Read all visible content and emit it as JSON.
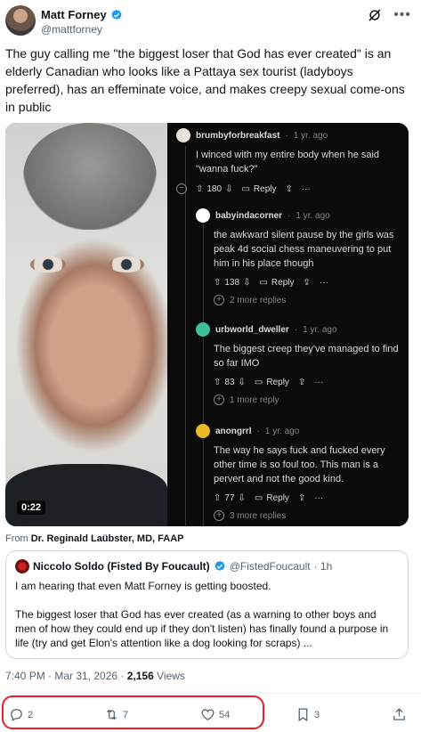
{
  "author": {
    "name": "Matt Forney",
    "handle": "@mattforney"
  },
  "tweet": {
    "text": "The guy calling me \"the biggest loser that God has ever created\" is an elderly Canadian who looks like a Pattaya sex tourist (ladyboys preferred), has an effeminate voice, and makes creepy sexual come-ons in public"
  },
  "media": {
    "duration": "0:22",
    "thread": [
      {
        "user": "brumbyforbreakfast",
        "time": "1 yr. ago",
        "body": "I winced with my entire body when he said \"wanna fuck?\"",
        "score": "180",
        "reply": "Reply",
        "more": ""
      },
      {
        "user": "babyindacorner",
        "time": "1 yr. ago",
        "body": "the awkward silent pause by the girls was peak 4d social chess maneuvering to put him in his place though",
        "score": "138",
        "reply": "Reply",
        "more": "2 more replies"
      },
      {
        "user": "urbworld_dweller",
        "time": "1 yr. ago",
        "body": "The biggest creep they've managed to find so far IMO",
        "score": "83",
        "reply": "Reply",
        "more": "1 more reply"
      },
      {
        "user": "anongrrl",
        "time": "1 yr. ago",
        "body": "The way he says fuck and fucked every other time is so foul too. This man is a pervert and not the good kind.",
        "score": "77",
        "reply": "Reply",
        "more": "3 more replies"
      }
    ],
    "separator": "·"
  },
  "source": {
    "prefix": "From",
    "name": "Dr. Reginald Laübster, MD, FAAP"
  },
  "quote": {
    "name": "Niccolo Soldo (Fisted By Foucault)",
    "handle": "@FistedFoucault",
    "time": "· 1h",
    "para1": "I am hearing that even Matt Forney is getting boosted.",
    "para2": "The biggest loser that God has ever created (as a warning to other boys and men of how they could end up if they don't listen) has finally found a purpose in life (try and get Elon's attention like a dog looking for scraps) ..."
  },
  "meta": {
    "time": "7:40 PM · Mar 31, 2026 ·",
    "views_count": "2,156",
    "views_label": "Views"
  },
  "actions": {
    "replies": "2",
    "reposts": "7",
    "likes": "54",
    "bookmarks": "3"
  },
  "colors": {
    "accent": "#1d9bf0",
    "highlight": "#e3202a"
  }
}
